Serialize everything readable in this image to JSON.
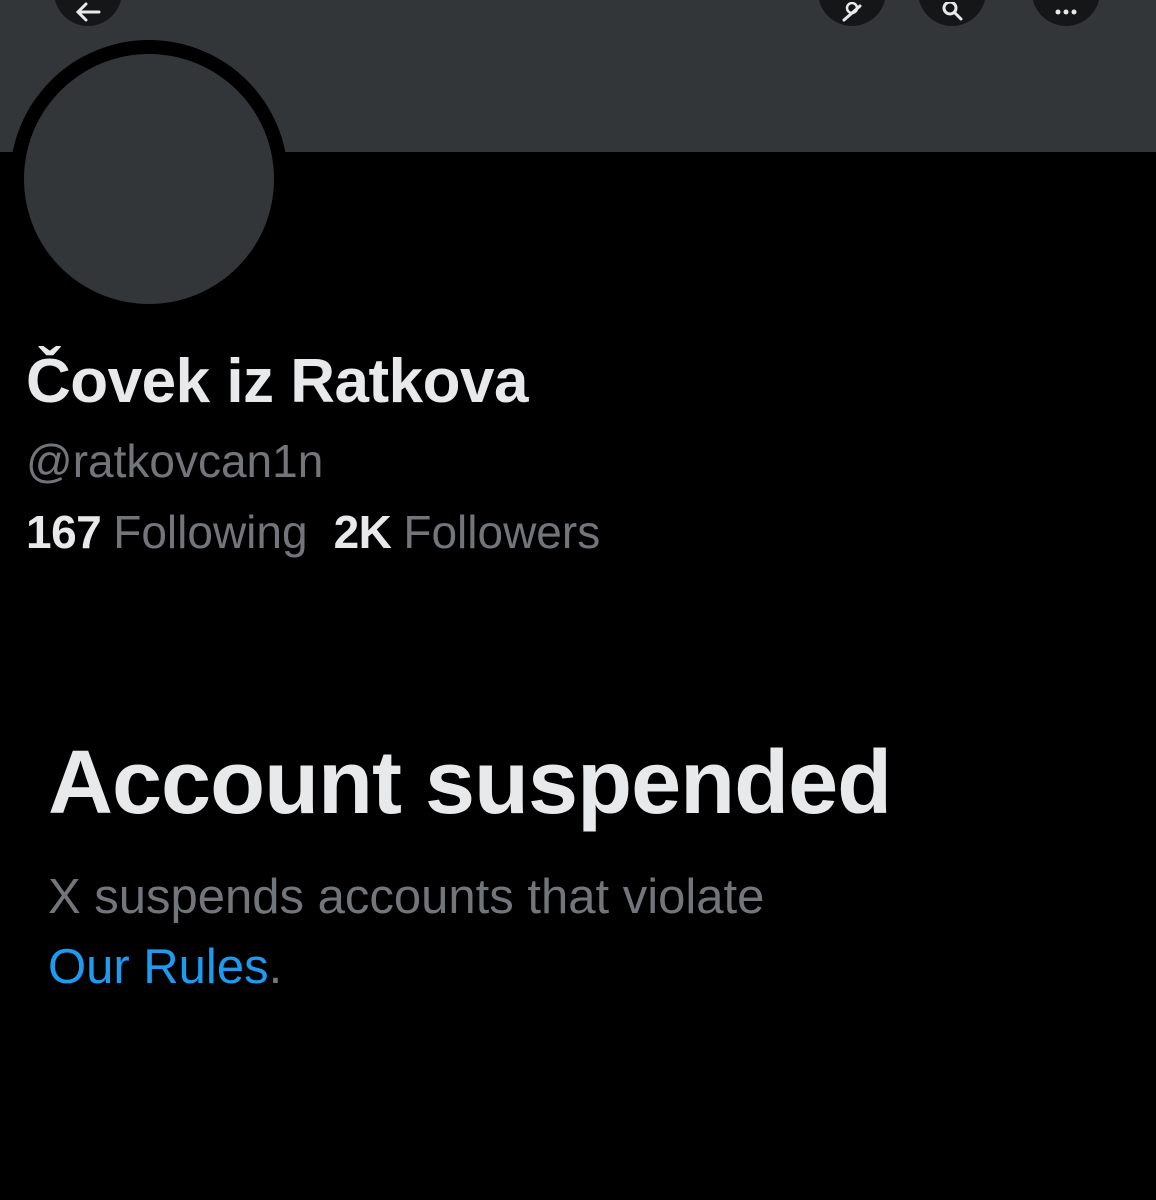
{
  "header": {
    "buttons": [
      {
        "icon": "back-arrow-icon"
      },
      {
        "icon": "grok-icon"
      },
      {
        "icon": "search-icon"
      },
      {
        "icon": "more-icon"
      }
    ]
  },
  "profile": {
    "display_name": "Čovek iz Ratkova",
    "handle": "@ratkovcan1n",
    "following_count": "167",
    "following_label": "Following",
    "followers_count": "2K",
    "followers_label": "Followers"
  },
  "suspension": {
    "title": "Account suspended",
    "message": "X suspends accounts that violate",
    "link_label": "Our Rules",
    "trailing": "."
  },
  "colors": {
    "background": "#000000",
    "banner": "#333639",
    "primary_text": "#e7e9ea",
    "secondary_text": "#71767b",
    "link": "#1d9bf0"
  }
}
